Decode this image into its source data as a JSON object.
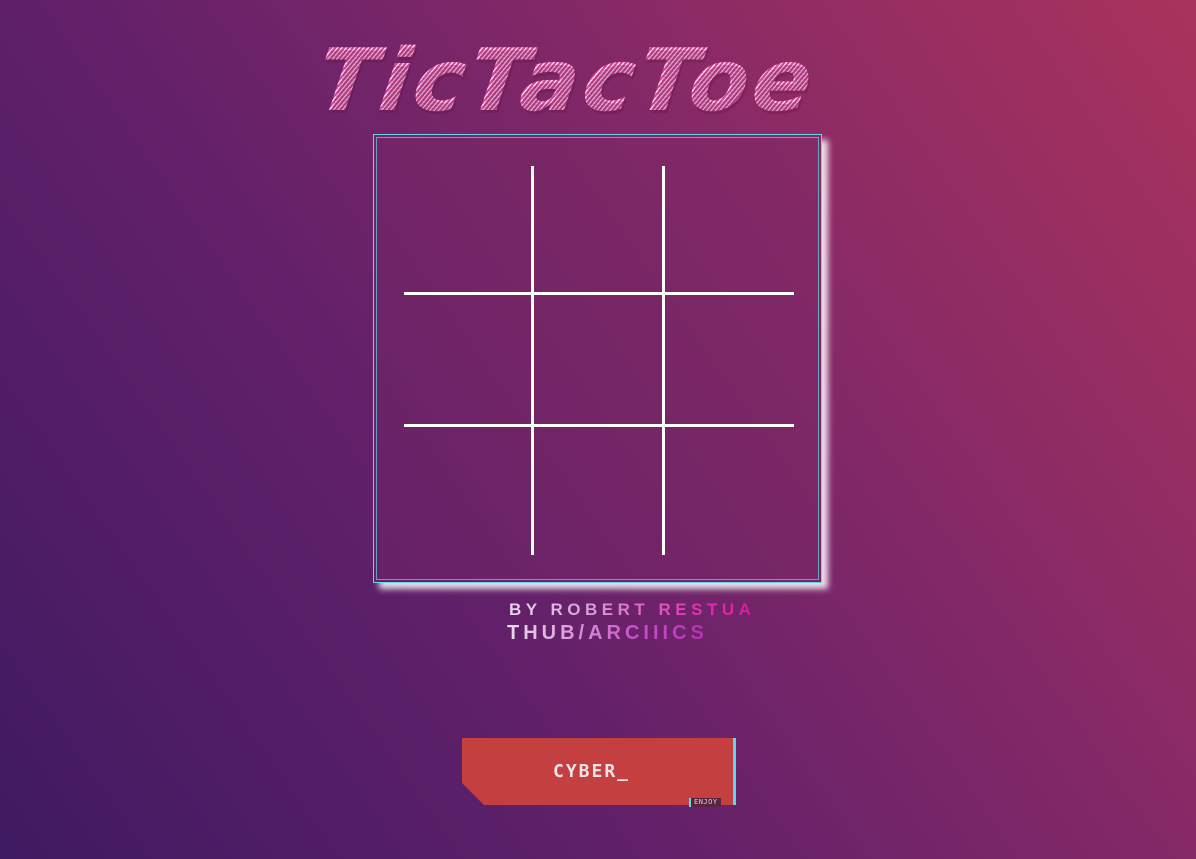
{
  "title": "TicTacToe",
  "board": {
    "cells": [
      "",
      "",
      "",
      "",
      "",
      "",
      "",
      "",
      ""
    ]
  },
  "credit": "BY ROBERT RESTUA",
  "link": "THUB/ARCIIICS",
  "button": {
    "label": "CYBER_",
    "tag": "ENJOY"
  },
  "colors": {
    "accent_cyan": "#5fd6ea",
    "button_red": "#c43f40",
    "grid_line": "#ffffff",
    "title_pink": "#d0489c"
  }
}
